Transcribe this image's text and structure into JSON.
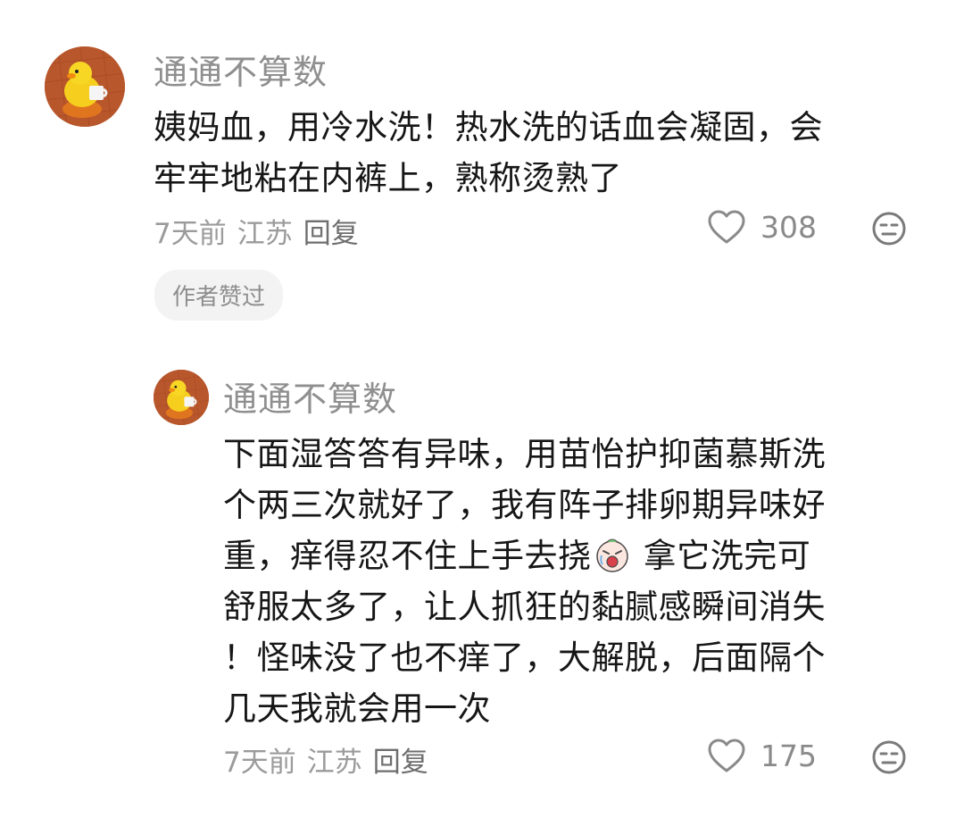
{
  "comments": [
    {
      "username": "通通不算数",
      "lines": [
        "姨妈血，用冷水洗！热水洗的话血会凝固，会",
        "牢牢地粘在内裤上，熟称烫熟了"
      ],
      "time": "7天前",
      "location": "江苏",
      "reply_label": "回复",
      "likes": "308",
      "badge": "作者赞过"
    },
    {
      "username": "通通不算数",
      "lines": [
        "下面湿答答有异味，用苗怡护抑菌慕斯洗",
        "个两三次就好了，我有阵子排卵期异味好",
        "重，痒得忍不住上手去挠",
        "舒服太多了，让人抓狂的黏腻感瞬间消失",
        "！怪味没了也不痒了，大解脱，后面隔个",
        "几天我就会用一次"
      ],
      "line3_after_emoji": " 拿它洗完可",
      "time": "7天前",
      "location": "江苏",
      "reply_label": "回复",
      "likes": "175"
    }
  ],
  "icons": {
    "like": "heart-outline-icon",
    "dislike": "meh-face-icon",
    "inline_emoji": "crying-face-emoji"
  },
  "colors": {
    "username": "#8f8f8f",
    "text": "#161616",
    "meta": "#9b9b9b",
    "badge_bg": "#f3f3f3",
    "avatar_bg": "#b5532a"
  }
}
